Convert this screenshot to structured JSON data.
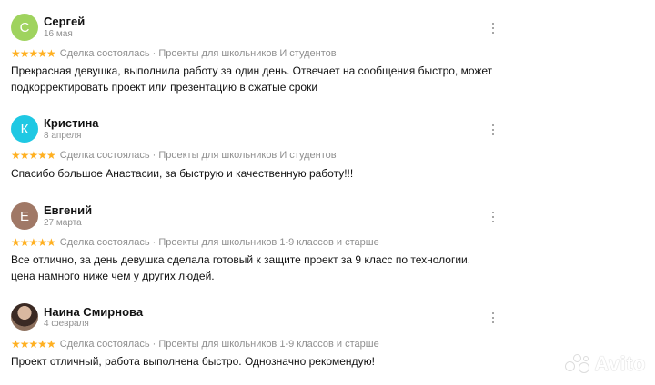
{
  "reviews": [
    {
      "author": "Сергей",
      "initial": "С",
      "avatar_color": "#9fd35e",
      "date": "16 мая",
      "stars": "★★★★★",
      "meta": "Сделка состоялась · Проекты для школьников И студентов",
      "text": "Прекрасная девушка, выполнила работу за один день. Отвечает на сообщения быстро, может подкорректировать проект или презентацию в сжатые сроки"
    },
    {
      "author": "Кристина",
      "initial": "К",
      "avatar_color": "#1fc8e3",
      "date": "8 апреля",
      "stars": "★★★★★",
      "meta": "Сделка состоялась · Проекты для школьников И студентов",
      "text": "Спасибо большое Анастасии, за быструю и качественную работу!!!"
    },
    {
      "author": "Евгений",
      "initial": "Е",
      "avatar_color": "#a07866",
      "date": "27 марта",
      "stars": "★★★★★",
      "meta": "Сделка состоялась · Проекты для школьников 1-9 классов и старше",
      "text": "Все отлично, за день девушка сделала готовый к защите проект за 9 класс по технологии, цена намного ниже чем у других людей."
    },
    {
      "author": "Наина Смирнова",
      "initial": "",
      "avatar_color": "",
      "date": "4 февраля",
      "stars": "★★★★★",
      "meta": "Сделка состоялась · Проекты для школьников 1-9 классов и старше",
      "text": "Проект отличный, работа выполнена быстро. Однозначно рекомендую!"
    }
  ],
  "watermark": {
    "text": "Avito",
    "icon": "avito-logo-icon"
  },
  "colors": {
    "star": "#ffb021",
    "meta_gray": "#8f8f8f"
  }
}
